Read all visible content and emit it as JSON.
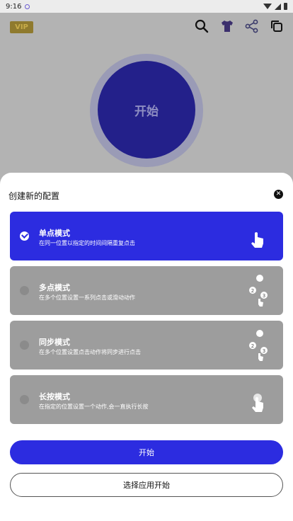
{
  "status_bar": {
    "time": "9:16"
  },
  "header": {
    "vip_label": "VIP"
  },
  "main": {
    "start_label": "开始"
  },
  "sheet": {
    "title": "创建新的配置",
    "modes": [
      {
        "title": "单点模式",
        "description": "在同一位置以指定的时间间隔重复点击",
        "selected": true,
        "icon": "single-tap-icon"
      },
      {
        "title": "多点模式",
        "description": "在多个位置设置一系列点击或滑动动作",
        "selected": false,
        "icon": "multi-tap-icon"
      },
      {
        "title": "同步模式",
        "description": "在多个位置设置点击动作将同步进行点击",
        "selected": false,
        "icon": "sync-tap-icon"
      },
      {
        "title": "长按模式",
        "description": "在指定的位置设置一个动作,会一直执行长按",
        "selected": false,
        "icon": "long-press-icon"
      }
    ],
    "start_button": "开始",
    "choose_app_button": "选择应用开始"
  },
  "colors": {
    "accent": "#2c2ce0",
    "main_button": "#23208a"
  }
}
